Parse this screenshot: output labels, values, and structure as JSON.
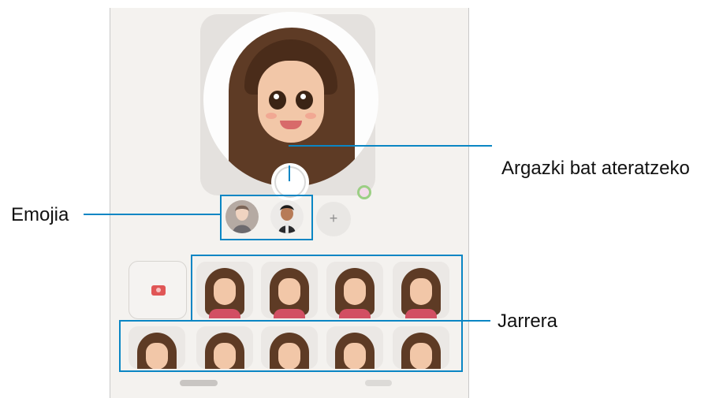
{
  "callouts": {
    "capture": "Argazki bat ateratzeko",
    "emoji": "Emojia",
    "pose": "Jarrera"
  },
  "add_emoji_label": "+",
  "colors": {
    "callout": "#0a86c4",
    "hair": "#5e3b25",
    "shirt": "#d24f63",
    "camera_icon": "#e05656"
  },
  "icons": [
    "camera-shutter-icon",
    "camera-icon",
    "effects-icon",
    "add-icon"
  ]
}
